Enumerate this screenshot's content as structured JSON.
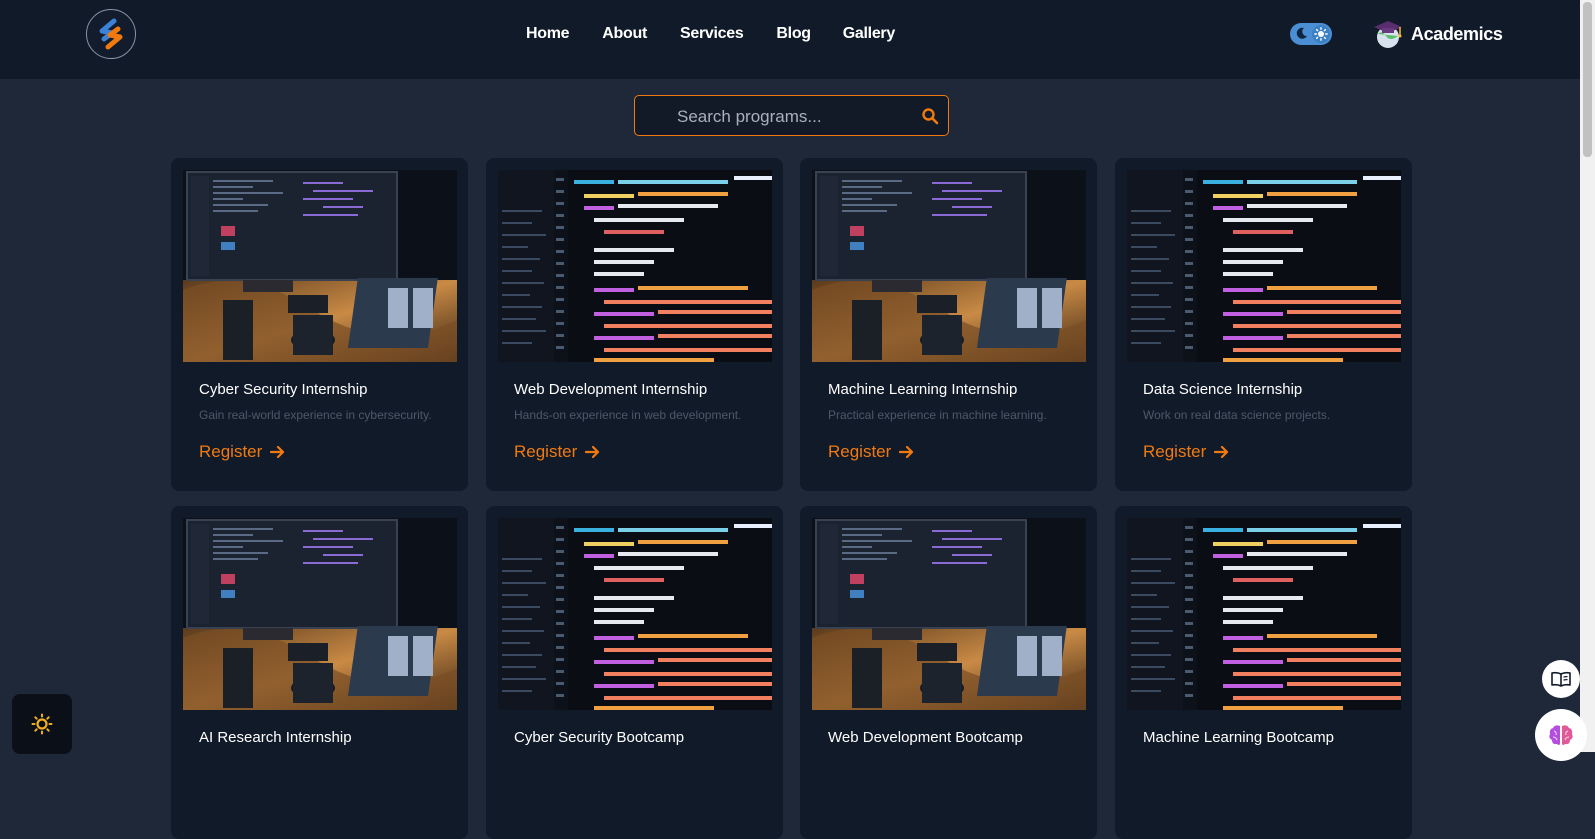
{
  "navbar": {
    "logo": "logo-icon",
    "links": [
      {
        "label": "Home"
      },
      {
        "label": "About"
      },
      {
        "label": "Services"
      },
      {
        "label": "Blog"
      },
      {
        "label": "Gallery"
      }
    ],
    "theme_toggle": {
      "icons": [
        "moon-icon",
        "sun-icon"
      ]
    },
    "academics": {
      "label": "Academics",
      "icon": "graduation-cap-icon"
    }
  },
  "search": {
    "placeholder": "Search programs...",
    "value": "",
    "icon": "search-icon"
  },
  "programs": [
    {
      "title": "Cyber Security Internship",
      "description": "Gain real-world experience in cybersecurity.",
      "cta": "Register",
      "image": "desk-workstation-image"
    },
    {
      "title": "Web Development Internship",
      "description": "Hands-on experience in web development.",
      "cta": "Register",
      "image": "code-editor-image"
    },
    {
      "title": "Machine Learning Internship",
      "description": "Practical experience in machine learning.",
      "cta": "Register",
      "image": "desk-workstation-image"
    },
    {
      "title": "Data Science Internship",
      "description": "Work on real data science projects.",
      "cta": "Register",
      "image": "code-editor-image"
    },
    {
      "title": "AI Research Internship",
      "description": "",
      "cta": "",
      "image": "desk-workstation-image"
    },
    {
      "title": "Cyber Security Bootcamp",
      "description": "",
      "cta": "",
      "image": "code-editor-image"
    },
    {
      "title": "Web Development Bootcamp",
      "description": "",
      "cta": "",
      "image": "desk-workstation-image"
    },
    {
      "title": "Machine Learning Bootcamp",
      "description": "",
      "cta": "",
      "image": "code-editor-image"
    }
  ],
  "floating": {
    "theme_button_icon": "sun-icon",
    "book_button_icon": "book-icon",
    "assistant_button_icon": "brain-icon"
  },
  "colors": {
    "page_bg": "#1e2838",
    "navbar_bg": "#111a29",
    "card_bg": "#111a29",
    "accent": "#f07a10",
    "toggle": "#4a8fd4"
  }
}
